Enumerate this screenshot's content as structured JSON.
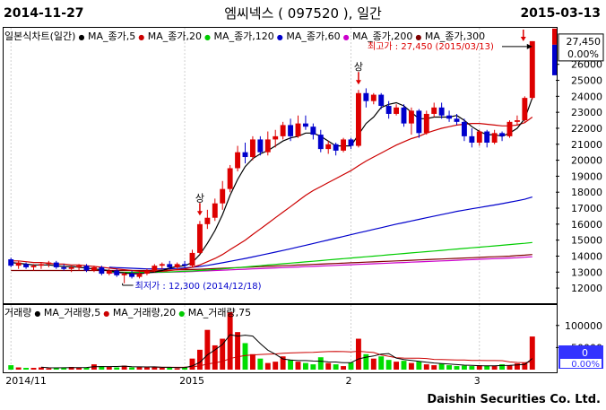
{
  "header": {
    "start_date": "2014-11-27",
    "title": "엠씨넥스 ( 097520 ), 일간",
    "end_date": "2015-03-13"
  },
  "price_legend": [
    {
      "label": "일본식차트(일간)",
      "color": "#000000"
    },
    {
      "label": "MA_종가,5",
      "color": "#000000"
    },
    {
      "label": "MA_종가,20",
      "color": "#cc0000"
    },
    {
      "label": "MA_종가,120",
      "color": "#00cc00"
    },
    {
      "label": "MA_종가,60",
      "color": "#0000cc"
    },
    {
      "label": "MA_종가,200",
      "color": "#cc00cc"
    },
    {
      "label": "MA_종가,300",
      "color": "#800000"
    }
  ],
  "volume_legend": [
    {
      "label": "거래량",
      "color": "#000000"
    },
    {
      "label": "MA_거래량,5",
      "color": "#000000"
    },
    {
      "label": "MA_거래량,20",
      "color": "#cc0000"
    },
    {
      "label": "MA_거래량,75",
      "color": "#00cc00"
    }
  ],
  "annotations": {
    "high_label": "최고가 : 27,450 (2015/03/13)",
    "low_label": "최저가 : 12,300 (2014/12/18)",
    "sang1": "상",
    "sang2": "상",
    "current_price": "27,450",
    "current_pct": "0.00%",
    "vol_current": "0",
    "vol_pct": "0.00%"
  },
  "footer": "Daishin Securities Co. Ltd.",
  "chart_data": {
    "type": "candlestick",
    "x_ticks": [
      "2014/11",
      "2015",
      "2",
      "3"
    ],
    "y_ticks": [
      12000,
      13000,
      14000,
      15000,
      16000,
      17000,
      18000,
      19000,
      20000,
      21000,
      22000,
      23000,
      24000,
      25000,
      26000
    ],
    "ylim": [
      11500,
      27500
    ],
    "volume_ticks": [
      "100000",
      "50000"
    ],
    "volume_ylim": [
      0,
      130000
    ],
    "candles": [
      [
        13800,
        13900,
        13300,
        13400
      ],
      [
        13400,
        13700,
        13200,
        13600
      ],
      [
        13500,
        13600,
        13200,
        13300
      ],
      [
        13300,
        13500,
        13100,
        13400
      ],
      [
        13400,
        13600,
        13200,
        13500
      ],
      [
        13500,
        13700,
        13300,
        13600
      ],
      [
        13600,
        13700,
        13200,
        13300
      ],
      [
        13300,
        13500,
        13100,
        13200
      ],
      [
        13200,
        13400,
        13000,
        13300
      ],
      [
        13300,
        13500,
        13100,
        13400
      ],
      [
        13400,
        13500,
        13000,
        13100
      ],
      [
        13100,
        13400,
        13000,
        13300
      ],
      [
        13300,
        13400,
        12800,
        12900
      ],
      [
        12900,
        13200,
        12800,
        13100
      ],
      [
        13100,
        13200,
        12700,
        12800
      ],
      [
        12800,
        13000,
        12300,
        12900
      ],
      [
        12900,
        13100,
        12600,
        12700
      ],
      [
        12700,
        13000,
        12600,
        12900
      ],
      [
        12900,
        13200,
        12800,
        13100
      ],
      [
        13100,
        13500,
        13000,
        13400
      ],
      [
        13400,
        13600,
        13200,
        13500
      ],
      [
        13500,
        13700,
        13200,
        13300
      ],
      [
        13300,
        13600,
        13200,
        13500
      ],
      [
        13500,
        13700,
        13300,
        13400
      ],
      [
        13400,
        14400,
        13300,
        14200
      ],
      [
        14200,
        16200,
        14100,
        16000
      ],
      [
        16000,
        16900,
        15700,
        16400
      ],
      [
        16400,
        17600,
        16200,
        17300
      ],
      [
        17300,
        18700,
        16900,
        18200
      ],
      [
        18200,
        19700,
        18000,
        19500
      ],
      [
        19500,
        20900,
        19300,
        20500
      ],
      [
        20500,
        21100,
        19800,
        20200
      ],
      [
        20200,
        21500,
        20000,
        21300
      ],
      [
        21300,
        21500,
        20300,
        20500
      ],
      [
        20500,
        21800,
        20300,
        21300
      ],
      [
        21300,
        21900,
        20800,
        21500
      ],
      [
        21500,
        22400,
        21300,
        22200
      ],
      [
        22200,
        22600,
        21200,
        21500
      ],
      [
        21500,
        22800,
        21400,
        22300
      ],
      [
        22300,
        22800,
        21900,
        22100
      ],
      [
        22100,
        22300,
        21300,
        21600
      ],
      [
        21600,
        21900,
        20500,
        20700
      ],
      [
        20700,
        21200,
        20400,
        21000
      ],
      [
        21000,
        21100,
        20300,
        20600
      ],
      [
        20600,
        21400,
        20500,
        21300
      ],
      [
        21300,
        21400,
        20700,
        20900
      ],
      [
        20900,
        24400,
        20800,
        24200
      ],
      [
        24200,
        24500,
        23300,
        23700
      ],
      [
        23700,
        24200,
        23500,
        24100
      ],
      [
        24100,
        24200,
        23200,
        23400
      ],
      [
        23400,
        23700,
        22600,
        22900
      ],
      [
        22900,
        23500,
        22800,
        23300
      ],
      [
        23300,
        23500,
        22100,
        22300
      ],
      [
        22300,
        23300,
        21600,
        23100
      ],
      [
        23100,
        23200,
        21400,
        21700
      ],
      [
        21700,
        23100,
        21600,
        22900
      ],
      [
        22900,
        23600,
        22700,
        23300
      ],
      [
        23300,
        23600,
        22600,
        22800
      ],
      [
        22800,
        23100,
        22400,
        22600
      ],
      [
        22600,
        22900,
        22200,
        22400
      ],
      [
        22400,
        22600,
        21200,
        21500
      ],
      [
        21500,
        22000,
        20800,
        21100
      ],
      [
        21100,
        21900,
        20900,
        21800
      ],
      [
        21800,
        21900,
        20800,
        21100
      ],
      [
        21100,
        21900,
        21000,
        21700
      ],
      [
        21700,
        21800,
        21200,
        21500
      ],
      [
        21500,
        22500,
        21400,
        22400
      ],
      [
        22400,
        22800,
        22200,
        22500
      ],
      [
        22500,
        24000,
        22400,
        23900
      ],
      [
        23900,
        27450,
        23800,
        27450
      ]
    ],
    "ma5": [
      13600,
      13550,
      13500,
      13450,
      13450,
      13450,
      13400,
      13350,
      13350,
      13300,
      13250,
      13200,
      13150,
      13100,
      13000,
      12950,
      12900,
      12900,
      12950,
      13000,
      13100,
      13250,
      13350,
      13400,
      13600,
      14100,
      14800,
      15600,
      16600,
      17800,
      18800,
      19600,
      20100,
      20400,
      20600,
      20900,
      21200,
      21400,
      21500,
      21700,
      21700,
      21500,
      21200,
      20900,
      20900,
      20900,
      21600,
      22300,
      22700,
      23300,
      23500,
      23600,
      23400,
      23000,
      22600,
      22600,
      22700,
      22700,
      22700,
      22800,
      22500,
      22100,
      21800,
      21600,
      21600,
      21500,
      21700,
      22000,
      22600,
      23900
    ],
    "ma20": [
      13700,
      13700,
      13650,
      13600,
      13600,
      13550,
      13500,
      13500,
      13450,
      13450,
      13400,
      13350,
      13300,
      13250,
      13200,
      13150,
      13100,
      13050,
      13050,
      13050,
      13050,
      13100,
      13150,
      13200,
      13300,
      13450,
      13650,
      13850,
      14100,
      14400,
      14700,
      15000,
      15350,
      15700,
      16050,
      16400,
      16750,
      17100,
      17450,
      17800,
      18100,
      18350,
      18600,
      18850,
      19100,
      19350,
      19650,
      19950,
      20200,
      20450,
      20700,
      20950,
      21150,
      21350,
      21500,
      21700,
      21850,
      22000,
      22100,
      22200,
      22250,
      22300,
      22300,
      22250,
      22200,
      22150,
      22150,
      22200,
      22350,
      22700
    ],
    "ma60": [
      null,
      null,
      null,
      null,
      null,
      null,
      null,
      null,
      null,
      null,
      null,
      null,
      null,
      13300,
      13280,
      13260,
      13240,
      13220,
      13200,
      13200,
      13200,
      13210,
      13230,
      13260,
      13300,
      13350,
      13420,
      13500,
      13580,
      13670,
      13760,
      13850,
      13950,
      14050,
      14150,
      14250,
      14350,
      14460,
      14570,
      14680,
      14790,
      14900,
      15010,
      15120,
      15230,
      15340,
      15450,
      15560,
      15670,
      15780,
      15890,
      16000,
      16100,
      16200,
      16300,
      16400,
      16500,
      16600,
      16700,
      16800,
      16880,
      16960,
      17040,
      17120,
      17200,
      17280,
      17370,
      17460,
      17560,
      17700
    ],
    "ma120": [
      null,
      null,
      null,
      null,
      null,
      null,
      null,
      null,
      null,
      null,
      null,
      null,
      null,
      13000,
      13000,
      12990,
      12990,
      12990,
      12990,
      12990,
      13000,
      13010,
      13030,
      13050,
      13070,
      13100,
      13130,
      13160,
      13200,
      13240,
      13280,
      13320,
      13360,
      13400,
      13440,
      13480,
      13520,
      13560,
      13600,
      13640,
      13680,
      13720,
      13760,
      13800,
      13840,
      13880,
      13920,
      13960,
      14000,
      14040,
      14080,
      14120,
      14160,
      14200,
      14240,
      14280,
      14320,
      14360,
      14400,
      14440,
      14480,
      14520,
      14560,
      14600,
      14640,
      14680,
      14720,
      14760,
      14800,
      14850
    ],
    "ma200": [
      null,
      null,
      null,
      null,
      null,
      null,
      null,
      null,
      null,
      null,
      null,
      null,
      null,
      12950,
      12950,
      12950,
      12960,
      12960,
      12970,
      12980,
      12990,
      13000,
      13010,
      13020,
      13040,
      13060,
      13080,
      13100,
      13120,
      13140,
      13160,
      13180,
      13200,
      13220,
      13240,
      13260,
      13280,
      13300,
      13320,
      13340,
      13360,
      13380,
      13400,
      13420,
      13440,
      13460,
      13480,
      13500,
      13520,
      13540,
      13560,
      13580,
      13600,
      13620,
      13640,
      13660,
      13680,
      13700,
      13720,
      13740,
      13760,
      13780,
      13800,
      13820,
      13840,
      13860,
      13880,
      13900,
      13930,
      13960
    ],
    "ma300": [
      13100,
      13100,
      13100,
      13100,
      13100,
      13100,
      13100,
      13100,
      13100,
      13100,
      13100,
      13100,
      13100,
      13100,
      13100,
      13100,
      13100,
      13100,
      13100,
      13110,
      13120,
      13130,
      13140,
      13150,
      13160,
      13180,
      13200,
      13220,
      13240,
      13260,
      13280,
      13300,
      13320,
      13340,
      13360,
      13380,
      13400,
      13420,
      13440,
      13460,
      13480,
      13500,
      13520,
      13540,
      13560,
      13580,
      13600,
      13620,
      13640,
      13660,
      13680,
      13700,
      13720,
      13740,
      13760,
      13780,
      13800,
      13820,
      13840,
      13860,
      13880,
      13900,
      13920,
      13940,
      13960,
      13980,
      14000,
      14030,
      14060,
      14100
    ],
    "volume": [
      10000,
      5000,
      4000,
      4000,
      5000,
      3000,
      4000,
      5000,
      6000,
      4000,
      5000,
      12000,
      8000,
      6000,
      5000,
      9000,
      5000,
      6000,
      5000,
      6000,
      4000,
      5000,
      3000,
      5000,
      25000,
      45000,
      90000,
      55000,
      70000,
      130000,
      85000,
      60000,
      35000,
      25000,
      15000,
      18000,
      30000,
      22000,
      18000,
      15000,
      12000,
      28000,
      15000,
      12000,
      8000,
      16000,
      70000,
      35000,
      25000,
      30000,
      22000,
      18000,
      20000,
      15000,
      18000,
      12000,
      10000,
      14000,
      10000,
      8000,
      9000,
      8000,
      10000,
      9000,
      8000,
      12000,
      10000,
      14000,
      15000,
      75000
    ],
    "vol_ma5": [
      null,
      null,
      null,
      null,
      5600,
      4200,
      4000,
      4200,
      4600,
      4400,
      4800,
      6400,
      7000,
      7000,
      7200,
      8000,
      6600,
      6200,
      6000,
      6200,
      5200,
      5200,
      4600,
      4600,
      8400,
      16600,
      33600,
      44600,
      57000,
      79000,
      76000,
      78000,
      76000,
      59000,
      44000,
      35000,
      24200,
      22000,
      20600,
      20600,
      19400,
      19000,
      17400,
      17200,
      15600,
      15800,
      24200,
      28200,
      30800,
      35200,
      36400,
      26000,
      23000,
      21000,
      18600,
      16600,
      15000,
      13800,
      12800,
      11400,
      10200,
      9800,
      9000,
      8800,
      8800,
      9400,
      9800,
      10600,
      11800,
      25200
    ],
    "vol_ma20": [
      null,
      null,
      null,
      null,
      null,
      null,
      null,
      null,
      null,
      null,
      null,
      null,
      null,
      null,
      null,
      null,
      null,
      null,
      null,
      5600,
      5300,
      5300,
      5300,
      5400,
      6400,
      8400,
      12800,
      15400,
      18600,
      25000,
      29000,
      31800,
      33300,
      34300,
      35000,
      35600,
      36900,
      37700,
      38300,
      38700,
      39100,
      40300,
      40800,
      41100,
      40800,
      40300,
      41600,
      40100,
      38800,
      33400,
      30200,
      27100,
      26300,
      25800,
      26000,
      25200,
      23200,
      22800,
      22400,
      22000,
      21900,
      21000,
      20800,
      20600,
      20600,
      20400,
      17400,
      16300,
      15800,
      18000
    ],
    "vol_ma75": [
      null,
      null,
      null,
      null,
      null,
      null,
      null,
      null,
      null,
      null,
      null,
      null,
      null,
      null,
      null,
      null,
      null,
      null,
      null,
      null,
      null,
      null,
      null,
      null,
      null,
      null,
      null,
      null,
      null,
      null,
      null,
      null,
      null,
      null,
      null,
      null,
      null,
      null,
      null,
      null,
      null,
      null,
      null,
      null,
      null,
      null,
      null,
      null,
      null,
      null,
      null,
      null,
      null,
      null,
      null,
      null,
      null,
      null,
      null,
      null,
      null,
      null,
      null,
      null,
      null,
      null,
      null,
      null,
      null,
      null
    ]
  }
}
